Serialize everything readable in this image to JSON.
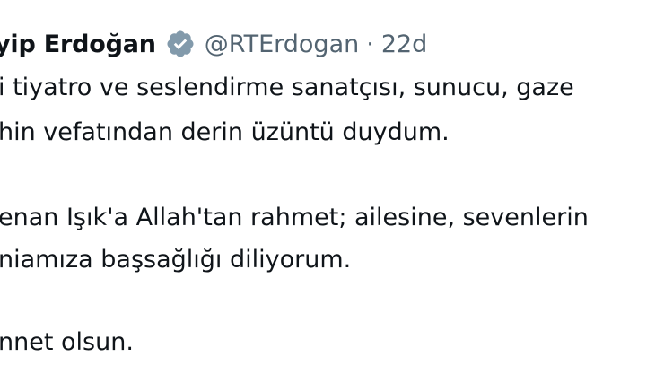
{
  "tweet": {
    "display_name": "yip Erdoğan",
    "handle": "@RTErdogan",
    "separator": "·",
    "time": "22d",
    "verified_icon": "verified-badge-icon",
    "lines": [
      "i tiyatro ve seslendirme sanatçısı, sunucu, gaze",
      "hin vefatından derin üzüntü duydum.",
      "enan Işık'a Allah'tan rahmet; ailesine, sevenlerin",
      "niamıza başsağlığı diliyorum.",
      "nnet olsun."
    ]
  },
  "colors": {
    "text": "#0f1419",
    "secondary": "#536471",
    "verified_badge": "#829aab",
    "background": "#ffffff"
  }
}
